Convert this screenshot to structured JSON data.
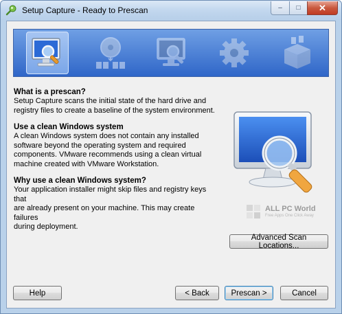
{
  "window": {
    "title": "Setup Capture - Ready to Prescan",
    "caption_buttons": {
      "minimize": "–",
      "maximize": "□",
      "close": "✕"
    }
  },
  "steps": [
    {
      "icon": "monitor-magnifier-icon",
      "state": "active"
    },
    {
      "icon": "disc-files-icon",
      "state": "inactive"
    },
    {
      "icon": "monitor-magnifier-icon",
      "state": "inactive"
    },
    {
      "icon": "gear-icon",
      "state": "inactive"
    },
    {
      "icon": "package-box-icon",
      "state": "inactive"
    }
  ],
  "sections": [
    {
      "heading": "What is a prescan?",
      "lines": [
        "Setup Capture scans the initial state of the hard drive and",
        "registry files to create a baseline of the system environment."
      ]
    },
    {
      "heading": "Use a clean Windows system",
      "lines": [
        "A clean Windows system does not contain any installed",
        "software beyond the operating system and required",
        "components. VMware recommends using a clean virtual",
        "machine created with VMware Workstation."
      ]
    },
    {
      "heading": "Why use a clean Windows system?",
      "lines": [
        "Your application installer might skip files and registry keys that",
        "are already present on your machine. This may create failures",
        "during deployment."
      ]
    }
  ],
  "watermark": {
    "title": "ALL PC World",
    "subtitle": "Free Apps One Click Away"
  },
  "buttons": {
    "advanced_scan": "Advanced Scan Locations...",
    "help": "Help",
    "back": "< Back",
    "prescan": "Prescan >",
    "cancel": "Cancel"
  },
  "colors": {
    "banner_top": "#6f9fe4",
    "banner_bottom": "#2f66c8",
    "dialog_bg": "#f0f0f0",
    "default_button_border": "#3c7fb1"
  }
}
